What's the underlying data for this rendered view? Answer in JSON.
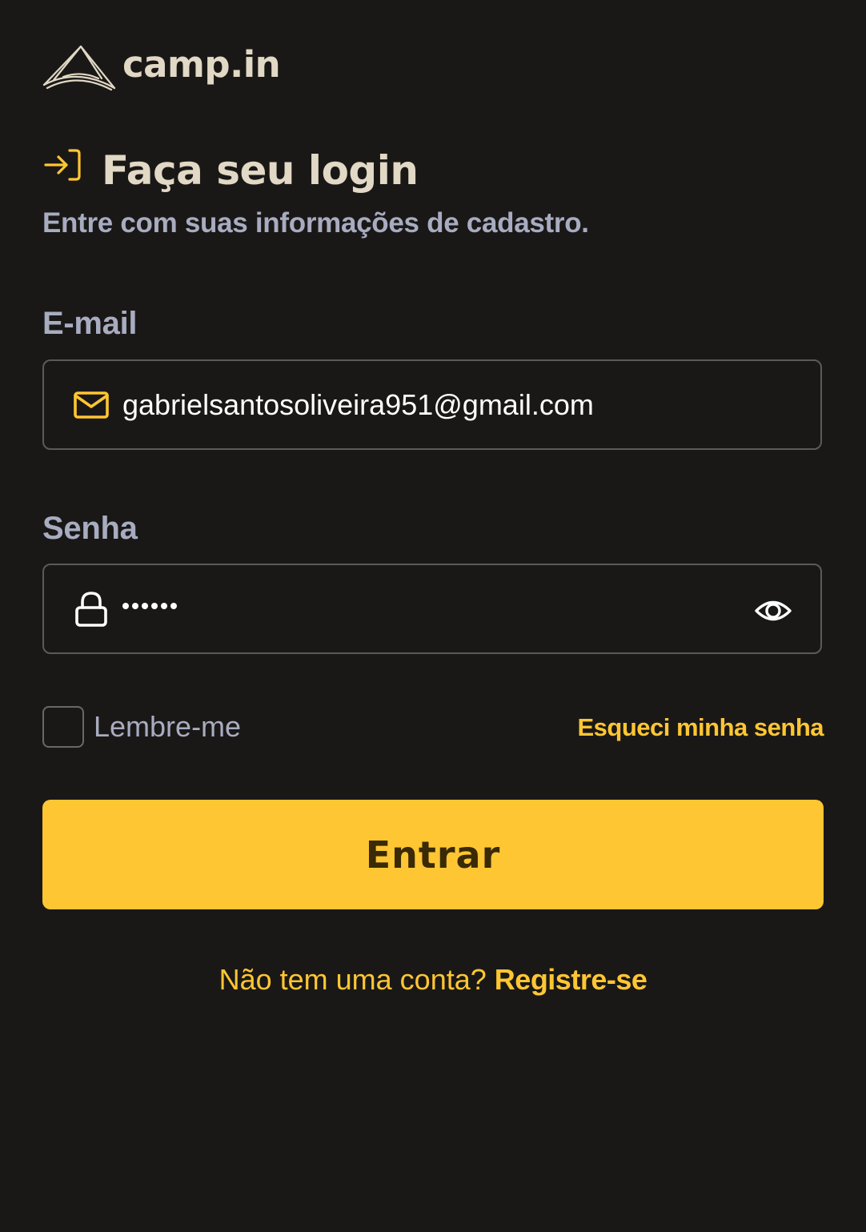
{
  "brand": {
    "name": "camp.in",
    "logo_icon": "tent-icon"
  },
  "heading": {
    "icon": "login-arrow-icon",
    "title": "Faça seu login",
    "subtitle": "Entre com suas informações de cadastro."
  },
  "form": {
    "email": {
      "label": "E-mail",
      "icon": "mail-icon",
      "value": "gabrielsantosoliveira951@gmail.com"
    },
    "password": {
      "label": "Senha",
      "icon": "lock-icon",
      "masked_length": 6,
      "toggle_icon": "eye-icon"
    },
    "remember": {
      "label": "Lembre-me",
      "checked": false
    },
    "forgot_link": "Esqueci minha senha",
    "submit_label": "Entrar"
  },
  "footer": {
    "prompt": "Não tem uma conta?",
    "register_link": "Registre-se"
  },
  "colors": {
    "background": "#1a1817",
    "accent": "#ffc633",
    "title": "#e1d8c5",
    "muted": "#a8acc0",
    "border": "#5c5a58"
  }
}
